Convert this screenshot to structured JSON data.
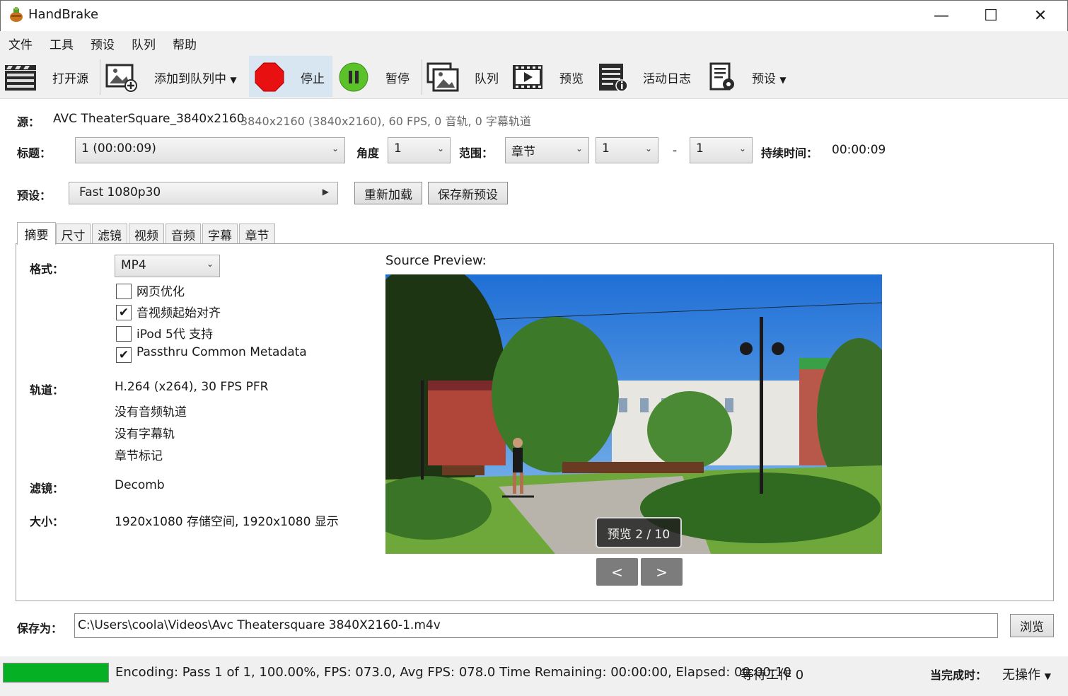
{
  "window": {
    "title": "HandBrake",
    "minimize": "—",
    "maximize": "☐",
    "close": "✕"
  },
  "menu": [
    "文件",
    "工具",
    "预设",
    "队列",
    "帮助"
  ],
  "toolbar": {
    "open_source": "打开源",
    "add_to_queue": "添加到队列中",
    "stop": "停止",
    "pause": "暂停",
    "queue": "队列",
    "preview": "预览",
    "activity_log": "活动日志",
    "presets": "预设"
  },
  "source": {
    "label": "源：",
    "name": "AVC TheaterSquare_3840x2160",
    "details": "3840x2160 (3840x2160), 60 FPS, 0 音轨, 0 字幕轨道"
  },
  "title_row": {
    "title_label": "标题：",
    "title_value": "1 (00:00:09)",
    "angle_label": "角度",
    "angle_value": "1",
    "range_label": "范围：",
    "range_type": "章节",
    "range_start": "1",
    "range_sep": "-",
    "range_end": "1",
    "duration_label": "持续时间：",
    "duration_value": "00:00:09"
  },
  "preset_row": {
    "label": "预设：",
    "value": "Fast 1080p30",
    "reload": "重新加载",
    "save_new": "保存新预设"
  },
  "tabs": [
    "摘要",
    "尺寸",
    "滤镜",
    "视频",
    "音频",
    "字幕",
    "章节"
  ],
  "summary": {
    "format_label": "格式：",
    "format_value": "MP4",
    "checkboxes": [
      {
        "label": "网页优化",
        "checked": false
      },
      {
        "label": "音视频起始对齐",
        "checked": true
      },
      {
        "label": "iPod 5代 支持",
        "checked": false
      },
      {
        "label": "Passthru Common Metadata",
        "checked": true
      }
    ],
    "tracks_label": "轨道：",
    "tracks": [
      "H.264 (x264), 30 FPS PFR",
      "没有音频轨道",
      "没有字幕轨",
      "章节标记"
    ],
    "filters_label": "滤镜：",
    "filters_value": "Decomb",
    "size_label": "大小：",
    "size_value": "1920x1080 存储空间, 1920x1080 显示"
  },
  "preview": {
    "heading": "Source Preview:",
    "badge": "预览 2 / 10",
    "prev": "<",
    "next": ">"
  },
  "save": {
    "label": "保存为：",
    "path": "C:\\Users\\coola\\Videos\\Avc Theatersquare 3840X2160-1.m4v",
    "browse": "浏览"
  },
  "status": {
    "progress": 1.0,
    "text": "Encoding: Pass 1 of 1,  100.00%, FPS: 073.0,  Avg FPS: 078.0 Time Remaining: 00:00:00,  Elapsed: 00:00:10",
    "queue": "等待工作 0",
    "when_done_label": "当完成时：",
    "when_done_value": "无操作"
  },
  "colors": {
    "progress_fill": "#06b025",
    "stop_red": "#e81010",
    "pause_green": "#5cc22a"
  }
}
